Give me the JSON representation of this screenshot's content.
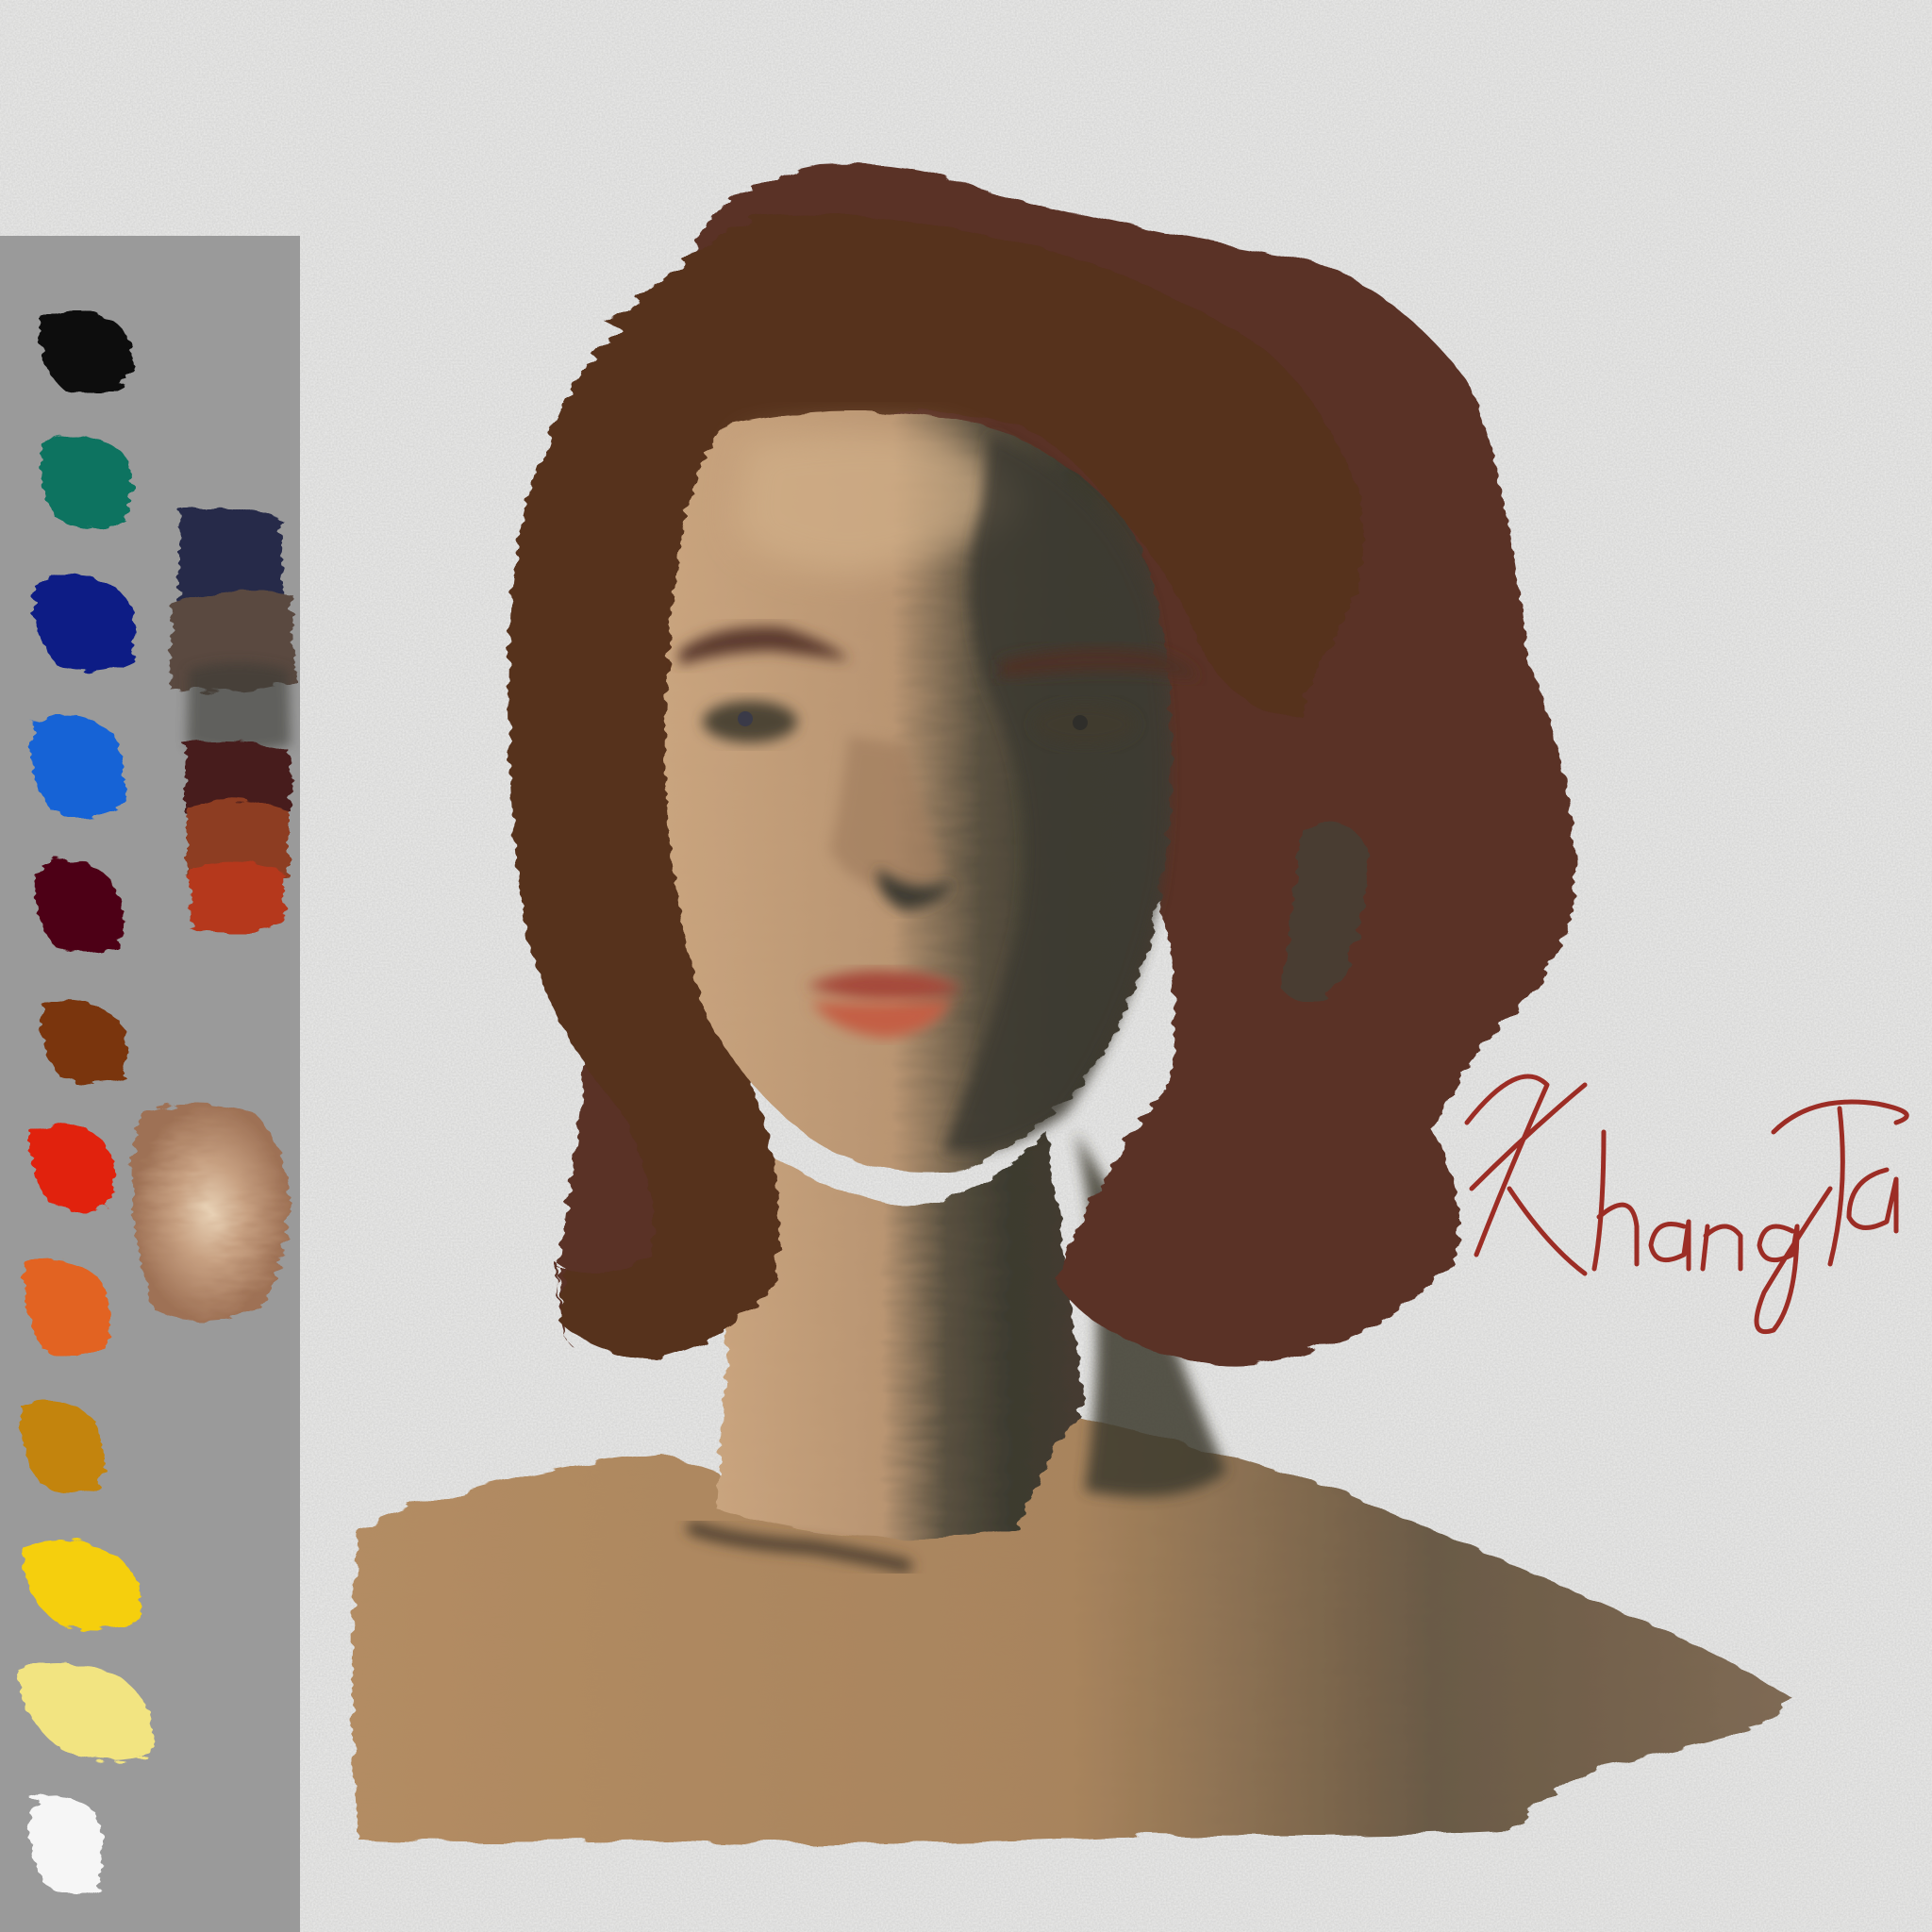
{
  "artwork": {
    "signature": "Khang Ta",
    "canvas_color": "#ebebea",
    "hair_color": "#5a3127",
    "skin_light": "#c4a27c",
    "skin_shadow": "#3d3b30",
    "lip_color": "#b5523c",
    "signature_color": "#9c2d25"
  },
  "palette": {
    "panel_color": "#9a9a9a",
    "swatches": [
      {
        "name": "black",
        "color": "#0c0b0b"
      },
      {
        "name": "viridian",
        "color": "#0d7360"
      },
      {
        "name": "ultramarine",
        "color": "#0a1d85"
      },
      {
        "name": "cerulean",
        "color": "#1763d6"
      },
      {
        "name": "alizarin",
        "color": "#4e0612"
      },
      {
        "name": "burnt-sienna",
        "color": "#7a3510"
      },
      {
        "name": "cadmium-red",
        "color": "#e1230f"
      },
      {
        "name": "cadmium-orange",
        "color": "#e26420"
      },
      {
        "name": "yellow-ochre",
        "color": "#c38410"
      },
      {
        "name": "cadmium-yellow",
        "color": "#f5cf0c"
      },
      {
        "name": "naples-yellow",
        "color": "#f2e481"
      },
      {
        "name": "titanium-white",
        "color": "#f6f6f6"
      }
    ],
    "mixes": [
      {
        "name": "dark-navy-mix",
        "color": "#262a48"
      },
      {
        "name": "warm-grey-mix",
        "color": "#5a4840"
      },
      {
        "name": "dark-brown-mix",
        "color": "#471f1c"
      },
      {
        "name": "rust-mix",
        "color": "#8d3d22"
      },
      {
        "name": "red-mix",
        "color": "#b5371f"
      },
      {
        "name": "skin-mix",
        "color": "#b99073"
      }
    ]
  }
}
